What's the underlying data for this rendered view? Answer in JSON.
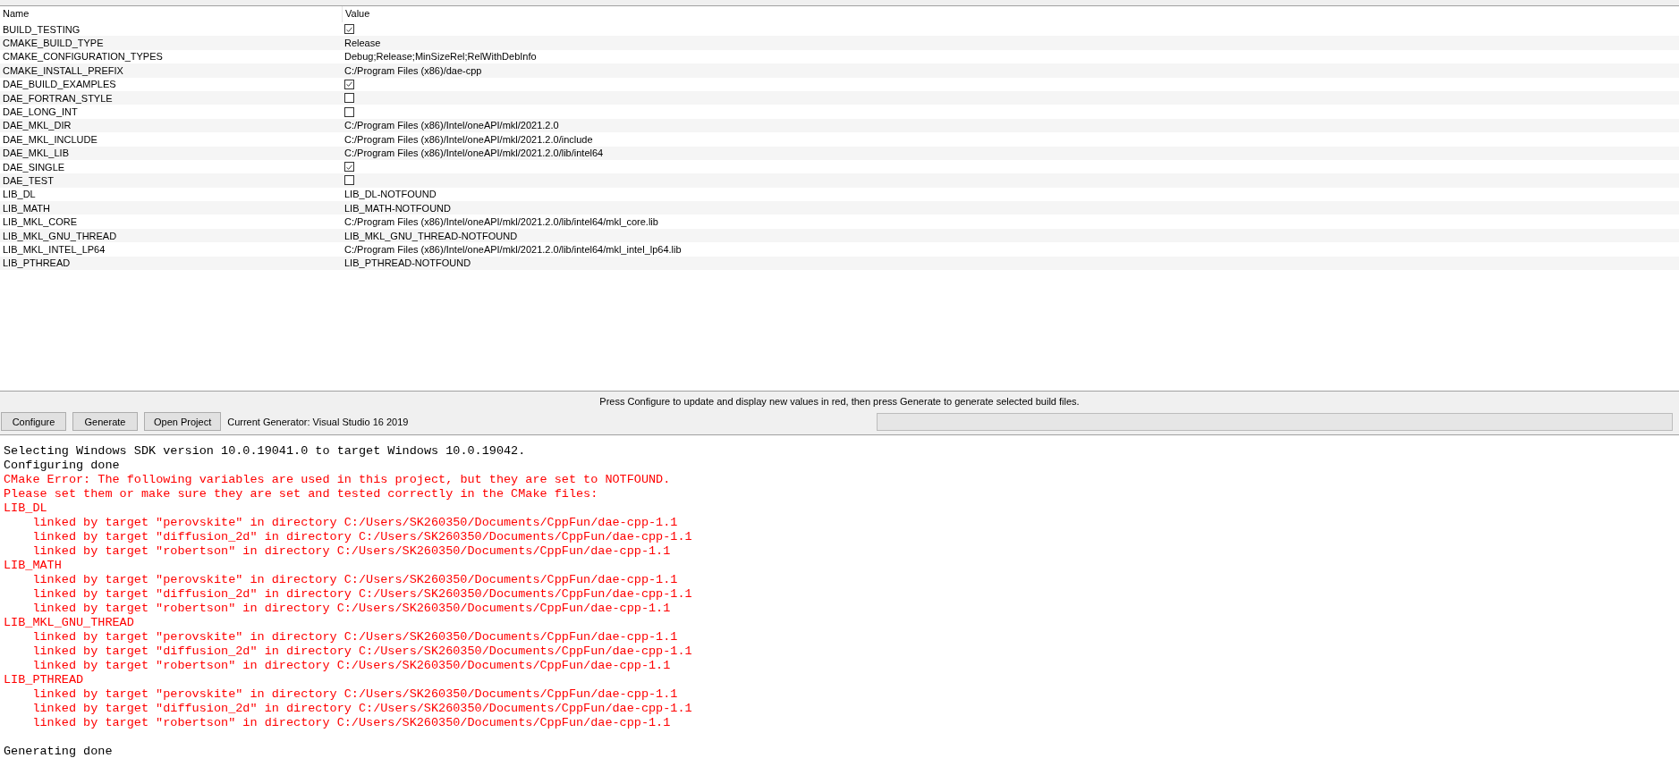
{
  "table": {
    "columns": [
      "Name",
      "Value"
    ],
    "rows": [
      {
        "name": "BUILD_TESTING",
        "kind": "checkbox",
        "checked": true
      },
      {
        "name": "CMAKE_BUILD_TYPE",
        "kind": "text",
        "value": "Release"
      },
      {
        "name": "CMAKE_CONFIGURATION_TYPES",
        "kind": "text",
        "value": "Debug;Release;MinSizeRel;RelWithDebInfo"
      },
      {
        "name": "CMAKE_INSTALL_PREFIX",
        "kind": "text",
        "value": "C:/Program Files (x86)/dae-cpp"
      },
      {
        "name": "DAE_BUILD_EXAMPLES",
        "kind": "checkbox",
        "checked": true
      },
      {
        "name": "DAE_FORTRAN_STYLE",
        "kind": "checkbox",
        "checked": false
      },
      {
        "name": "DAE_LONG_INT",
        "kind": "checkbox",
        "checked": false
      },
      {
        "name": "DAE_MKL_DIR",
        "kind": "text",
        "value": "C:/Program Files (x86)/Intel/oneAPI/mkl/2021.2.0"
      },
      {
        "name": "DAE_MKL_INCLUDE",
        "kind": "text",
        "value": "C:/Program Files (x86)/Intel/oneAPI/mkl/2021.2.0/include"
      },
      {
        "name": "DAE_MKL_LIB",
        "kind": "text",
        "value": "C:/Program Files (x86)/Intel/oneAPI/mkl/2021.2.0/lib/intel64"
      },
      {
        "name": "DAE_SINGLE",
        "kind": "checkbox",
        "checked": true
      },
      {
        "name": "DAE_TEST",
        "kind": "checkbox",
        "checked": false
      },
      {
        "name": "LIB_DL",
        "kind": "text",
        "value": "LIB_DL-NOTFOUND"
      },
      {
        "name": "LIB_MATH",
        "kind": "text",
        "value": "LIB_MATH-NOTFOUND"
      },
      {
        "name": "LIB_MKL_CORE",
        "kind": "text",
        "value": "C:/Program Files (x86)/Intel/oneAPI/mkl/2021.2.0/lib/intel64/mkl_core.lib"
      },
      {
        "name": "LIB_MKL_GNU_THREAD",
        "kind": "text",
        "value": "LIB_MKL_GNU_THREAD-NOTFOUND"
      },
      {
        "name": "LIB_MKL_INTEL_LP64",
        "kind": "text",
        "value": "C:/Program Files (x86)/Intel/oneAPI/mkl/2021.2.0/lib/intel64/mkl_intel_lp64.lib"
      },
      {
        "name": "LIB_PTHREAD",
        "kind": "text",
        "value": "LIB_PTHREAD-NOTFOUND"
      }
    ]
  },
  "hint": "Press Configure to update and display new values in red, then press Generate to generate selected build files.",
  "buttons": [
    "Configure",
    "Generate",
    "Open Project"
  ],
  "generator": "Current Generator: Visual Studio 16 2019",
  "progress": {
    "level": 0
  },
  "log": [
    {
      "kind": "plain",
      "text": "Selecting Windows SDK version 10.0.19041.0 to target Windows 10.0.19042."
    },
    {
      "kind": "plain",
      "text": "Configuring done"
    },
    {
      "kind": "error",
      "text": "CMake Error: The following variables are used in this project, but they are set to NOTFOUND."
    },
    {
      "kind": "error",
      "text": "Please set them or make sure they are set and tested correctly in the CMake files:"
    },
    {
      "kind": "error",
      "text": "LIB_DL"
    },
    {
      "kind": "error-detail",
      "text": "linked by target \"perovskite\" in directory C:/Users/SK260350/Documents/CppFun/dae-cpp-1.1"
    },
    {
      "kind": "error-detail",
      "text": "linked by target \"diffusion_2d\" in directory C:/Users/SK260350/Documents/CppFun/dae-cpp-1.1"
    },
    {
      "kind": "error-detail",
      "text": "linked by target \"robertson\" in directory C:/Users/SK260350/Documents/CppFun/dae-cpp-1.1"
    },
    {
      "kind": "error",
      "text": "LIB_MATH"
    },
    {
      "kind": "error-detail",
      "text": "linked by target \"perovskite\" in directory C:/Users/SK260350/Documents/CppFun/dae-cpp-1.1"
    },
    {
      "kind": "error-detail",
      "text": "linked by target \"diffusion_2d\" in directory C:/Users/SK260350/Documents/CppFun/dae-cpp-1.1"
    },
    {
      "kind": "error-detail",
      "text": "linked by target \"robertson\" in directory C:/Users/SK260350/Documents/CppFun/dae-cpp-1.1"
    },
    {
      "kind": "error",
      "text": "LIB_MKL_GNU_THREAD"
    },
    {
      "kind": "error-detail",
      "text": "linked by target \"perovskite\" in directory C:/Users/SK260350/Documents/CppFun/dae-cpp-1.1"
    },
    {
      "kind": "error-detail",
      "text": "linked by target \"diffusion_2d\" in directory C:/Users/SK260350/Documents/CppFun/dae-cpp-1.1"
    },
    {
      "kind": "error-detail",
      "text": "linked by target \"robertson\" in directory C:/Users/SK260350/Documents/CppFun/dae-cpp-1.1"
    },
    {
      "kind": "error",
      "text": "LIB_PTHREAD"
    },
    {
      "kind": "error-detail",
      "text": "linked by target \"perovskite\" in directory C:/Users/SK260350/Documents/CppFun/dae-cpp-1.1"
    },
    {
      "kind": "error-detail",
      "text": "linked by target \"diffusion_2d\" in directory C:/Users/SK260350/Documents/CppFun/dae-cpp-1.1"
    },
    {
      "kind": "error-detail",
      "text": "linked by target \"robertson\" in directory C:/Users/SK260350/Documents/CppFun/dae-cpp-1.1"
    },
    {
      "kind": "blank"
    },
    {
      "kind": "plain",
      "text": "Generating done"
    }
  ]
}
